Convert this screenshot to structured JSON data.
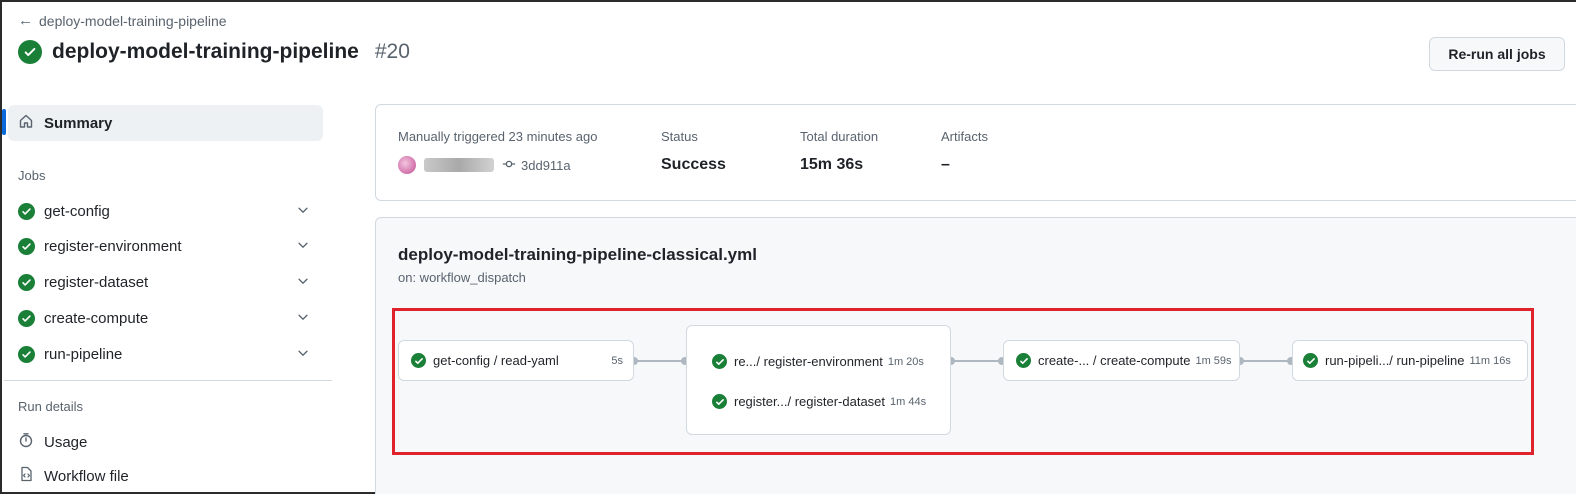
{
  "header": {
    "back_label": "deploy-model-training-pipeline",
    "title": "deploy-model-training-pipeline",
    "run_number": "#20",
    "rerun_label": "Re-run all jobs"
  },
  "sidebar": {
    "summary_label": "Summary",
    "jobs_heading": "Jobs",
    "jobs": [
      {
        "label": "get-config"
      },
      {
        "label": "register-environment"
      },
      {
        "label": "register-dataset"
      },
      {
        "label": "create-compute"
      },
      {
        "label": "run-pipeline"
      }
    ],
    "run_details_heading": "Run details",
    "usage_label": "Usage",
    "workflow_file_label": "Workflow file"
  },
  "summary": {
    "trigger_label": "Manually triggered 23 minutes ago",
    "commit": "3dd911a",
    "status_label": "Status",
    "status_value": "Success",
    "duration_label": "Total duration",
    "duration_value": "15m 36s",
    "artifacts_label": "Artifacts",
    "artifacts_value": "–"
  },
  "graph": {
    "workflow_name": "deploy-model-training-pipeline-classical.yml",
    "trigger": "on: workflow_dispatch",
    "nodes": [
      {
        "label": "get-config / read-yaml",
        "duration": "5s"
      },
      {
        "label": "re.../ register-environment",
        "duration": "1m 20s"
      },
      {
        "label": "register.../ register-dataset",
        "duration": "1m 44s"
      },
      {
        "label": "create-... / create-compute",
        "duration": "1m 59s"
      },
      {
        "label": "run-pipeli.../ run-pipeline",
        "duration": "11m 16s"
      }
    ]
  },
  "colors": {
    "success": "#1a7f37",
    "accent": "#0969da",
    "highlight": "#e0222b"
  }
}
